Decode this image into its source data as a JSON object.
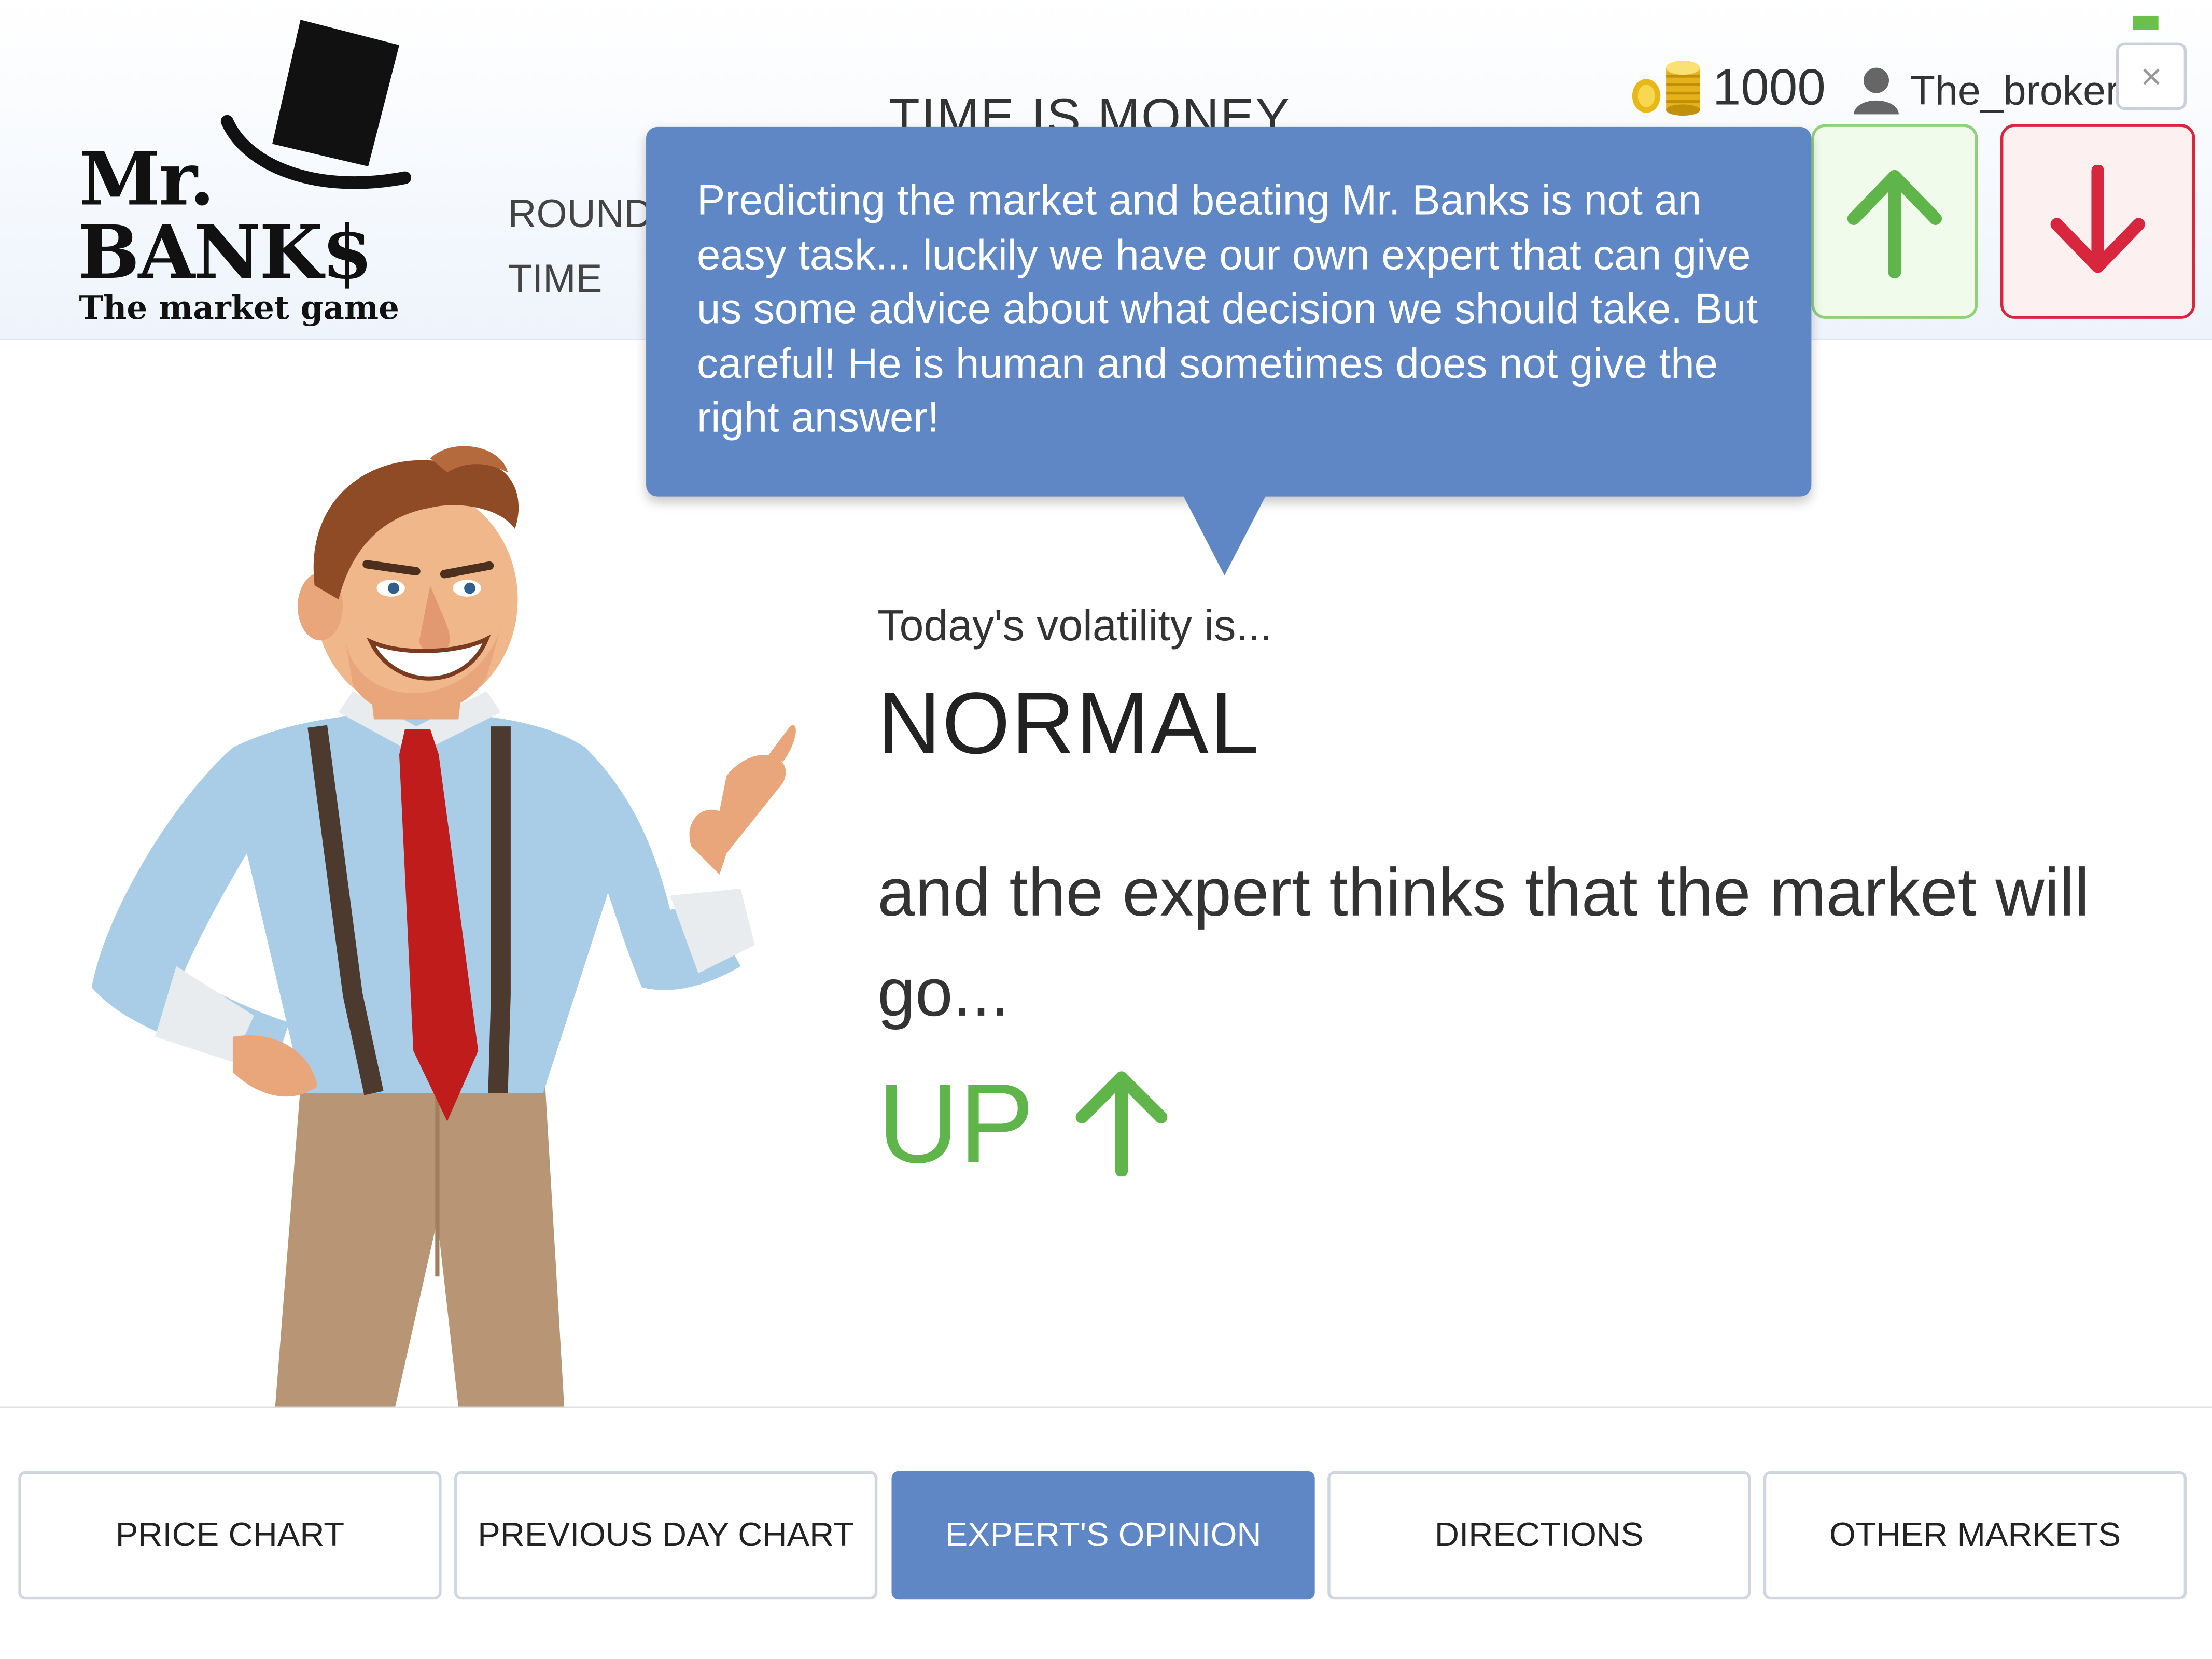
{
  "header": {
    "logo": {
      "line1": "Mr.",
      "line2": "BANK$",
      "tagline": "The market game"
    },
    "round_label": "ROUND",
    "time_label": "TIME",
    "title": "TIME IS MONEY",
    "coins": "1000",
    "username": "The_broker",
    "close_symbol": "×"
  },
  "tooltip": {
    "text": "Predicting the market and beating Mr. Banks is not an easy task... luckily we have our own expert that can give us some advice about what decision we should take. But careful! He is human and sometimes does not give the right answer!"
  },
  "expert": {
    "volatility_label": "Today's volatility is...",
    "volatility_value": "NORMAL",
    "prediction_text": "and the expert thinks that the market will go...",
    "prediction_value": "UP"
  },
  "tabs": [
    {
      "label": "PRICE CHART",
      "active": false
    },
    {
      "label": "PREVIOUS DAY CHART",
      "active": false
    },
    {
      "label": "EXPERT'S OPINION",
      "active": true
    },
    {
      "label": "DIRECTIONS",
      "active": false
    },
    {
      "label": "OTHER MARKETS",
      "active": false
    }
  ],
  "colors": {
    "accent_blue": "#5f87c6",
    "up_green": "#5fb44a",
    "down_red": "#d9263f"
  },
  "icons": {
    "hat": "top-hat-icon",
    "coins": "coin-stack-icon",
    "user": "user-icon",
    "up": "arrow-up-icon",
    "down": "arrow-down-icon",
    "close": "close-icon"
  }
}
